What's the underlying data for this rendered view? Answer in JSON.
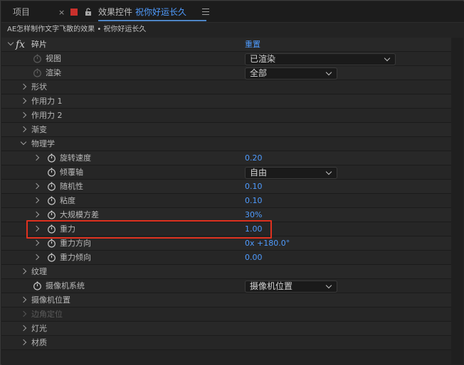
{
  "tabs": {
    "project": "项目",
    "close": "×",
    "effects_prefix": "效果控件",
    "effects_name": "祝你好运长久"
  },
  "subheader": "AE怎样制作文字飞散的效果 • 祝你好运长久",
  "effect": {
    "fx": "fx",
    "name": "碎片",
    "reset": "重置"
  },
  "props": {
    "view": {
      "label": "视图",
      "value": "已渲染"
    },
    "render": {
      "label": "渲染",
      "value": "全部"
    },
    "shape": {
      "label": "形状"
    },
    "force1": {
      "label": "作用力 1"
    },
    "force2": {
      "label": "作用力 2"
    },
    "gradient": {
      "label": "渐变"
    },
    "physics": {
      "label": "物理学"
    },
    "rot_speed": {
      "label": "旋转速度",
      "value": "0.20"
    },
    "tumble_axis": {
      "label": "倾覆轴",
      "value": "自由"
    },
    "randomness": {
      "label": "随机性",
      "value": "0.10"
    },
    "viscosity": {
      "label": "粘度",
      "value": "0.10"
    },
    "mass_variance": {
      "label": "大规模方差",
      "value": "30%"
    },
    "gravity": {
      "label": "重力",
      "value": "1.00"
    },
    "gravity_dir": {
      "label": "重力方向",
      "value": "0x +180.0°"
    },
    "gravity_tilt": {
      "label": "重力倾向",
      "value": "0.00"
    },
    "texture": {
      "label": "纹理"
    },
    "camera_system": {
      "label": "摄像机系统",
      "value": "摄像机位置"
    },
    "camera_pos": {
      "label": "摄像机位置"
    },
    "corner_pin": {
      "label": "边角定位"
    },
    "lighting": {
      "label": "灯光"
    },
    "material": {
      "label": "材质"
    }
  },
  "colors": {
    "accent_blue": "#4f9cff",
    "highlight_red": "#e0311f",
    "label_color": "#b9b9b9"
  }
}
